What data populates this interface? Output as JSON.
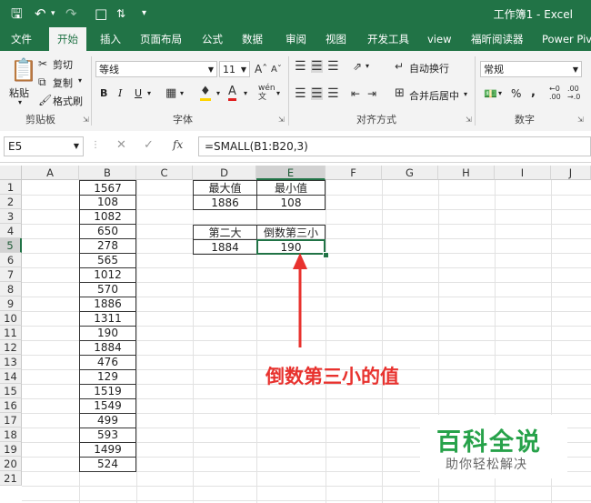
{
  "app": {
    "title": "工作簿1 - Excel"
  },
  "tabs": [
    "文件",
    "开始",
    "插入",
    "页面布局",
    "公式",
    "数据",
    "审阅",
    "视图",
    "开发工具",
    "view",
    "福昕阅读器",
    "Power Pivot"
  ],
  "ribbon": {
    "paste": "粘贴",
    "cut": "剪切",
    "copy": "复制",
    "format_painter": "格式刷",
    "clipboard_label": "剪贴板",
    "font_name": "等线",
    "font_size": "11",
    "font_label": "字体",
    "bold": "B",
    "italic": "I",
    "underline": "U",
    "wrap_text": "自动换行",
    "merge_center": "合并后居中",
    "alignment_label": "对齐方式",
    "number_format": "常规",
    "number_label": "数字",
    "percent": "%",
    "comma": ","
  },
  "formula_bar": {
    "name_box": "E5",
    "fx": "fx",
    "formula": "=SMALL(B1:B20,3)"
  },
  "columns": [
    "A",
    "B",
    "C",
    "D",
    "E",
    "F",
    "G",
    "H",
    "I",
    "J"
  ],
  "rows": [
    "1",
    "2",
    "3",
    "4",
    "5",
    "6",
    "7",
    "8",
    "9",
    "10",
    "11",
    "12",
    "13",
    "14",
    "15",
    "16",
    "17",
    "18",
    "19",
    "20",
    "21"
  ],
  "column_b": [
    "1567",
    "108",
    "1082",
    "650",
    "278",
    "565",
    "1012",
    "570",
    "1886",
    "1311",
    "190",
    "1884",
    "476",
    "129",
    "1519",
    "1549",
    "499",
    "593",
    "1499",
    "524"
  ],
  "table": {
    "d1": "最大值",
    "e1": "最小值",
    "d2": "1886",
    "e2": "108",
    "d4": "第二大",
    "e4": "倒数第三小",
    "d5": "1884",
    "e5": "190"
  },
  "annotation": "倒数第三小的值",
  "watermark": {
    "title": "百科全说",
    "subtitle": "助你轻松解决"
  },
  "colors": {
    "accent": "#217346",
    "annotation": "#e8322e",
    "watermark": "#27a24a"
  }
}
